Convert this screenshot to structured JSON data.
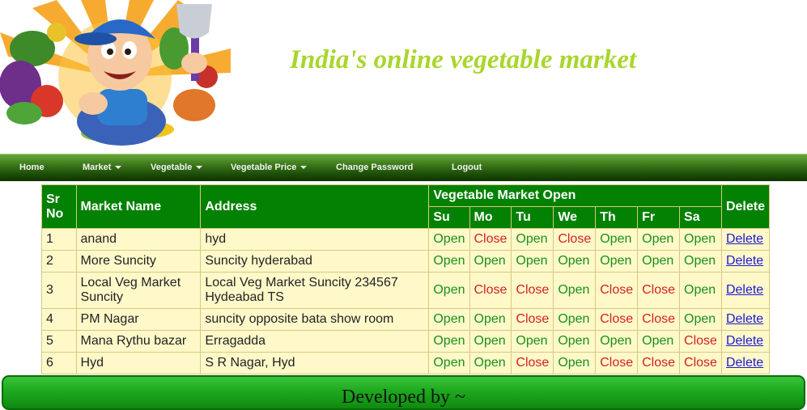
{
  "header": {
    "tagline": "India's online vegetable market"
  },
  "nav": {
    "items": [
      {
        "label": "Home"
      },
      {
        "label": "Market"
      },
      {
        "label": "Vegetable"
      },
      {
        "label": "Vegetable Price"
      },
      {
        "label": "Change Password"
      },
      {
        "label": "Logout"
      }
    ]
  },
  "table": {
    "headers": {
      "sr_no_line1": "Sr",
      "sr_no_line2": "No",
      "market_name": "Market Name",
      "address": "Address",
      "open_group": "Vegetable Market Open",
      "days": [
        "Su",
        "Mo",
        "Tu",
        "We",
        "Th",
        "Fr",
        "Sa"
      ],
      "delete": "Delete"
    },
    "rows": [
      {
        "sr": "1",
        "name": "anand",
        "address": "hyd",
        "days": [
          "Open",
          "Close",
          "Open",
          "Close",
          "Open",
          "Open",
          "Open"
        ],
        "action": "Delete"
      },
      {
        "sr": "2",
        "name": "More Suncity",
        "address": "Suncity hyderabad",
        "days": [
          "Open",
          "Open",
          "Open",
          "Open",
          "Open",
          "Open",
          "Open"
        ],
        "action": "Delete"
      },
      {
        "sr": "3",
        "name": "Local Veg Market Suncity",
        "address": "Local Veg Market Suncity 234567 Hydeabad TS",
        "days": [
          "Open",
          "Close",
          "Close",
          "Open",
          "Close",
          "Close",
          "Open"
        ],
        "action": "Delete"
      },
      {
        "sr": "4",
        "name": "PM Nagar",
        "address": "suncity opposite bata show room",
        "days": [
          "Open",
          "Open",
          "Close",
          "Open",
          "Close",
          "Close",
          "Open"
        ],
        "action": "Delete"
      },
      {
        "sr": "5",
        "name": "Mana Rythu bazar",
        "address": "Erragadda",
        "days": [
          "Open",
          "Open",
          "Open",
          "Open",
          "Open",
          "Open",
          "Close"
        ],
        "action": "Delete"
      },
      {
        "sr": "6",
        "name": "Hyd",
        "address": "S R Nagar, Hyd",
        "days": [
          "Open",
          "Open",
          "Close",
          "Open",
          "Close",
          "Close",
          "Close"
        ],
        "action": "Delete"
      }
    ]
  },
  "footer": {
    "text": "Developed by ~"
  },
  "colors": {
    "tagline": "#a9d62c",
    "header_green": "#028102",
    "row_bg": "#fff9c9",
    "open": "#1a8f1a",
    "close": "#d42020"
  }
}
